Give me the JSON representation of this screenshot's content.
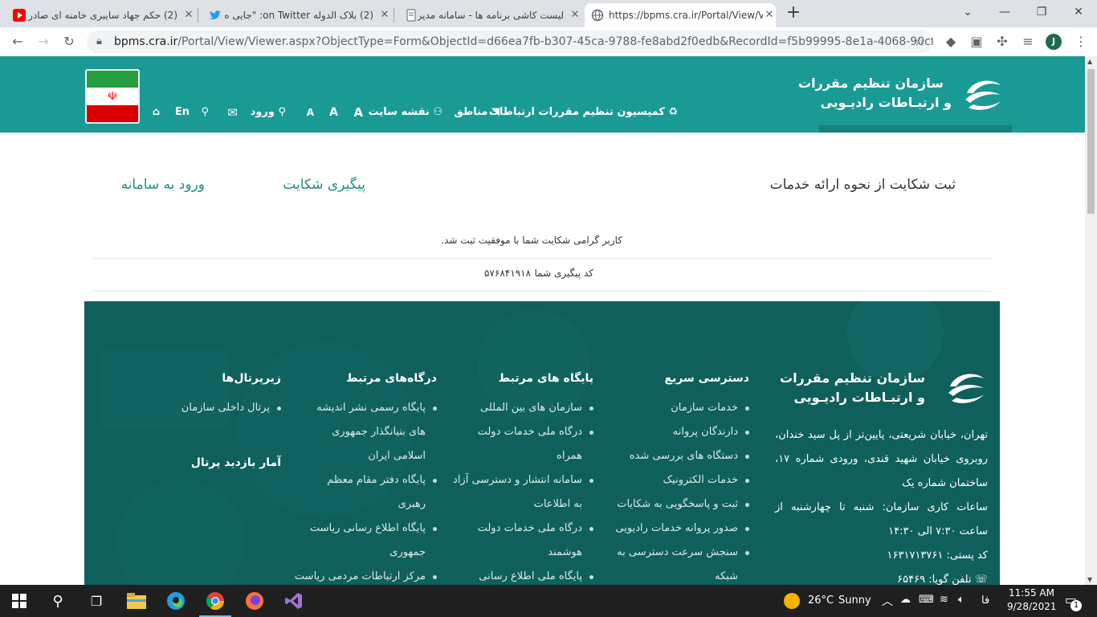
{
  "tabs": [
    {
      "title": "(2) حکم جهاد سایبری خامنه ای صادر",
      "icon": "youtube-icon"
    },
    {
      "title": "(2) بلاک الدوله on Twitter: \"جایی ه",
      "icon": "twitter-icon"
    },
    {
      "title": "لیست کاشی برنامه ها - سامانه مدیر",
      "icon": "page-icon"
    },
    {
      "title": "https://bpms.cra.ir/Portal/View/V",
      "icon": "globe-icon"
    }
  ],
  "address_bar": {
    "host": "bpms.cra.ir",
    "path": "/Portal/View/Viewer.aspx?ObjectType=Form&ObjectId=d66ea7fb-b307-45ca-9788-fe8abd2f0edb&RecordId=f5b99995-8e1a-4068-90cf-f0fd54f4d..."
  },
  "profile_initial": "J",
  "header": {
    "org_name_line1": "سازمان تنظیم مقررات",
    "org_name_line2": "و ارتبـاطات رادیـویی",
    "nav": {
      "commission": "کمیسیون تنظیم مقررات ارتباطات",
      "regions": "مناطق",
      "sitemap": "نقشه سایت",
      "font_large": "A",
      "font_medium": "A",
      "font_small": "A",
      "login": "ورود",
      "english": "En"
    }
  },
  "content": {
    "complaint_form_link": "ثبت شکایت از نحوه ارائه خدمات",
    "tracking_link": "پیگیری  شکایت",
    "system_login_link": "ورود به سامانه",
    "success_message": "کاربر گرامی شکایت شما با موفقیت ثبت شد.",
    "tracking_code_label": "کد پیگیری شما",
    "tracking_code": "۵۷۶۸۴۱۹۱۸"
  },
  "footer": {
    "org_name_line1": "سازمان تنظیم مقررات",
    "org_name_line2": "و ارتبـاطات رادیـویی",
    "address": "تهران، خیابان شریعتی، پایین‌تر از پل سید خندان، روبروی خیابان شهید قندی، ورودی شماره ۱۷، ساختمان شماره یک",
    "hours": "ساعات کاری سازمان: شنبه تا چهارشنبه از ساعت ۷:۳۰ الی ۱۴:۳۰",
    "postal_code": "کد پستی: ۱۶۳۱۷۱۳۷۶۱",
    "phone_partial": "تلفن گویا: ۶۵۴۶۹",
    "quick_access": {
      "title": "دسترسی سریع",
      "items": [
        "خدمات سازمان",
        "دارندگان پروانه",
        "دستگاه های بررسی شده",
        "خدمات الکترونیک",
        "ثبت و پاسخگویی به شکایات",
        "صدور پروانه خدمات رادیویی",
        "سنجش سرعت دسترسی به",
        "شبکه"
      ]
    },
    "related_sites": {
      "title": "پایگاه های مرتبط",
      "items": [
        "سازمان های بین المللی",
        "درگاه ملی خدمات دولت",
        "همراه",
        "سامانه انتشار و دسترسی آزاد",
        "به اطلاعات",
        "درگاه ملی خدمات دولت",
        "هوشمند",
        "پایگاه ملی اطلاع رسانی"
      ]
    },
    "related_portals": {
      "title": "درگاه‌های مرتبط",
      "items": [
        "پایگاه رسمی نشر اندیشه",
        "های بنیانگذار جمهوری",
        "اسلامی ایران",
        "پایگاه دفتر مقام معظم",
        "رهبری",
        "پایگاه اطلاع رسانی ریاست",
        "جمهوری",
        "مرکز ارتباطات مردمی ریاست"
      ]
    },
    "subportals": {
      "title": "زیرپرتال‌ها",
      "items": [
        "پرتال داخلی سازمان"
      ]
    },
    "visit_stats_title": "آمار بازدید پرتال"
  },
  "taskbar": {
    "weather_temp": "26°C",
    "weather_text": "Sunny",
    "lang": "فا",
    "time": "11:55 AM",
    "date": "9/28/2021",
    "notifications": "1"
  },
  "colors": {
    "brand_teal": "#1a9a94",
    "footer_teal": "#0f5f5d",
    "link_teal": "#1f8c86"
  }
}
